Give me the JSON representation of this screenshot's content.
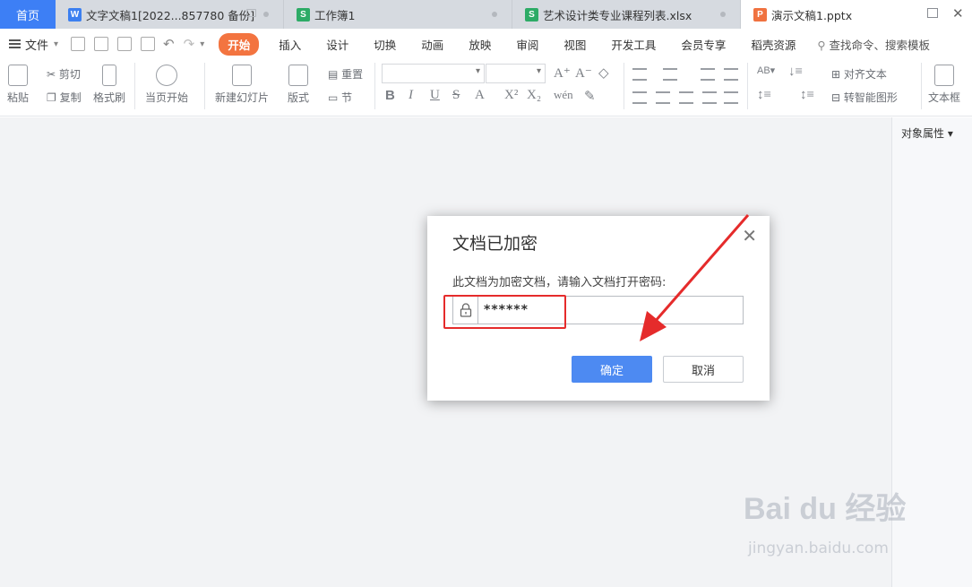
{
  "tabs": {
    "home": "首页",
    "items": [
      {
        "label": "文字文稿1[2022...857780 备份]",
        "icon": "W",
        "color": "#3b7ff0"
      },
      {
        "label": "工作簿1",
        "icon": "S",
        "color": "#2dab66"
      },
      {
        "label": "艺术设计类专业课程列表.xlsx",
        "icon": "S",
        "color": "#2dab66"
      },
      {
        "label": "演示文稿1.pptx",
        "icon": "P",
        "color": "#f07240"
      }
    ]
  },
  "menu": {
    "file": "文件",
    "items": [
      "开始",
      "插入",
      "设计",
      "切换",
      "动画",
      "放映",
      "审阅",
      "视图",
      "开发工具",
      "会员专享",
      "稻壳资源"
    ],
    "search": "查找命令、搜索模板"
  },
  "ribbon": {
    "paste": "粘贴",
    "cut": "剪切",
    "copy": "复制",
    "format_painter": "格式刷",
    "from_current": "当页开始",
    "new_slide": "新建幻灯片",
    "layout": "版式",
    "reset": "重置",
    "section": "节",
    "align_text": "对齐文本",
    "smart_shape": "转智能图形",
    "textbox": "文本框"
  },
  "right_panel": {
    "title": "对象属性"
  },
  "dialog": {
    "title": "文档已加密",
    "prompt": "此文档为加密文档，请输入文档打开密码:",
    "password_value": "******",
    "ok": "确定",
    "cancel": "取消"
  },
  "watermark": {
    "logo": "Bai du 经验",
    "url": "jingyan.baidu.com"
  },
  "colors": {
    "accent": "#4d8af2",
    "active_menu": "#f37440",
    "annotation": "#e52b2b"
  }
}
